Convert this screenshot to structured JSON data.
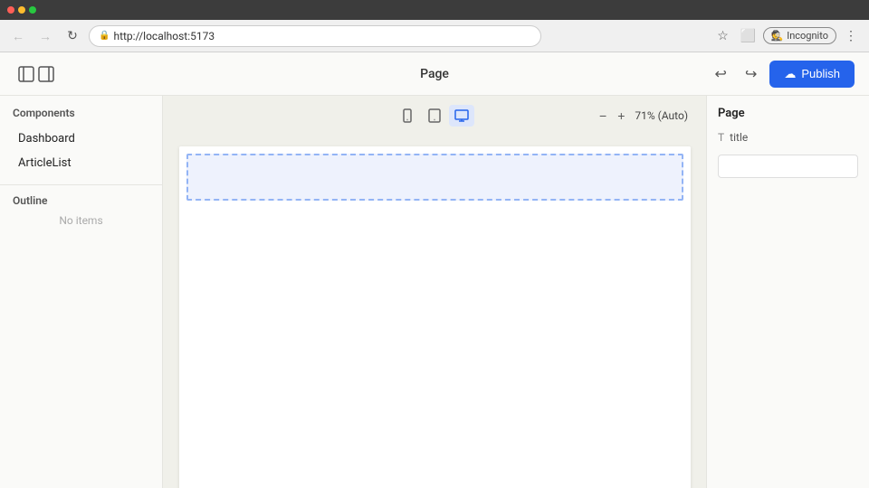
{
  "browser": {
    "url": "http://localhost:5173",
    "incognito_label": "Incognito"
  },
  "header": {
    "title": "Page",
    "publish_label": "Publish",
    "undo_symbol": "↩",
    "redo_symbol": "↪"
  },
  "left_sidebar": {
    "components_title": "Components",
    "items": [
      {
        "label": "Dashboard"
      },
      {
        "label": "ArticleList"
      }
    ],
    "outline_title": "Outline",
    "outline_empty": "No items"
  },
  "canvas": {
    "zoom_label": "71% (Auto)",
    "devices": [
      {
        "id": "mobile",
        "symbol": "📱"
      },
      {
        "id": "tablet",
        "symbol": "⬜"
      },
      {
        "id": "desktop",
        "symbol": "🖥"
      }
    ]
  },
  "right_sidebar": {
    "title": "Page",
    "prop_icon": "T",
    "prop_label": "title",
    "prop_input_value": ""
  },
  "icons": {
    "panels": "⊡⊡",
    "drag": "⋮⋮",
    "zoom_out": "−",
    "zoom_in": "+",
    "cloud": "☁"
  }
}
